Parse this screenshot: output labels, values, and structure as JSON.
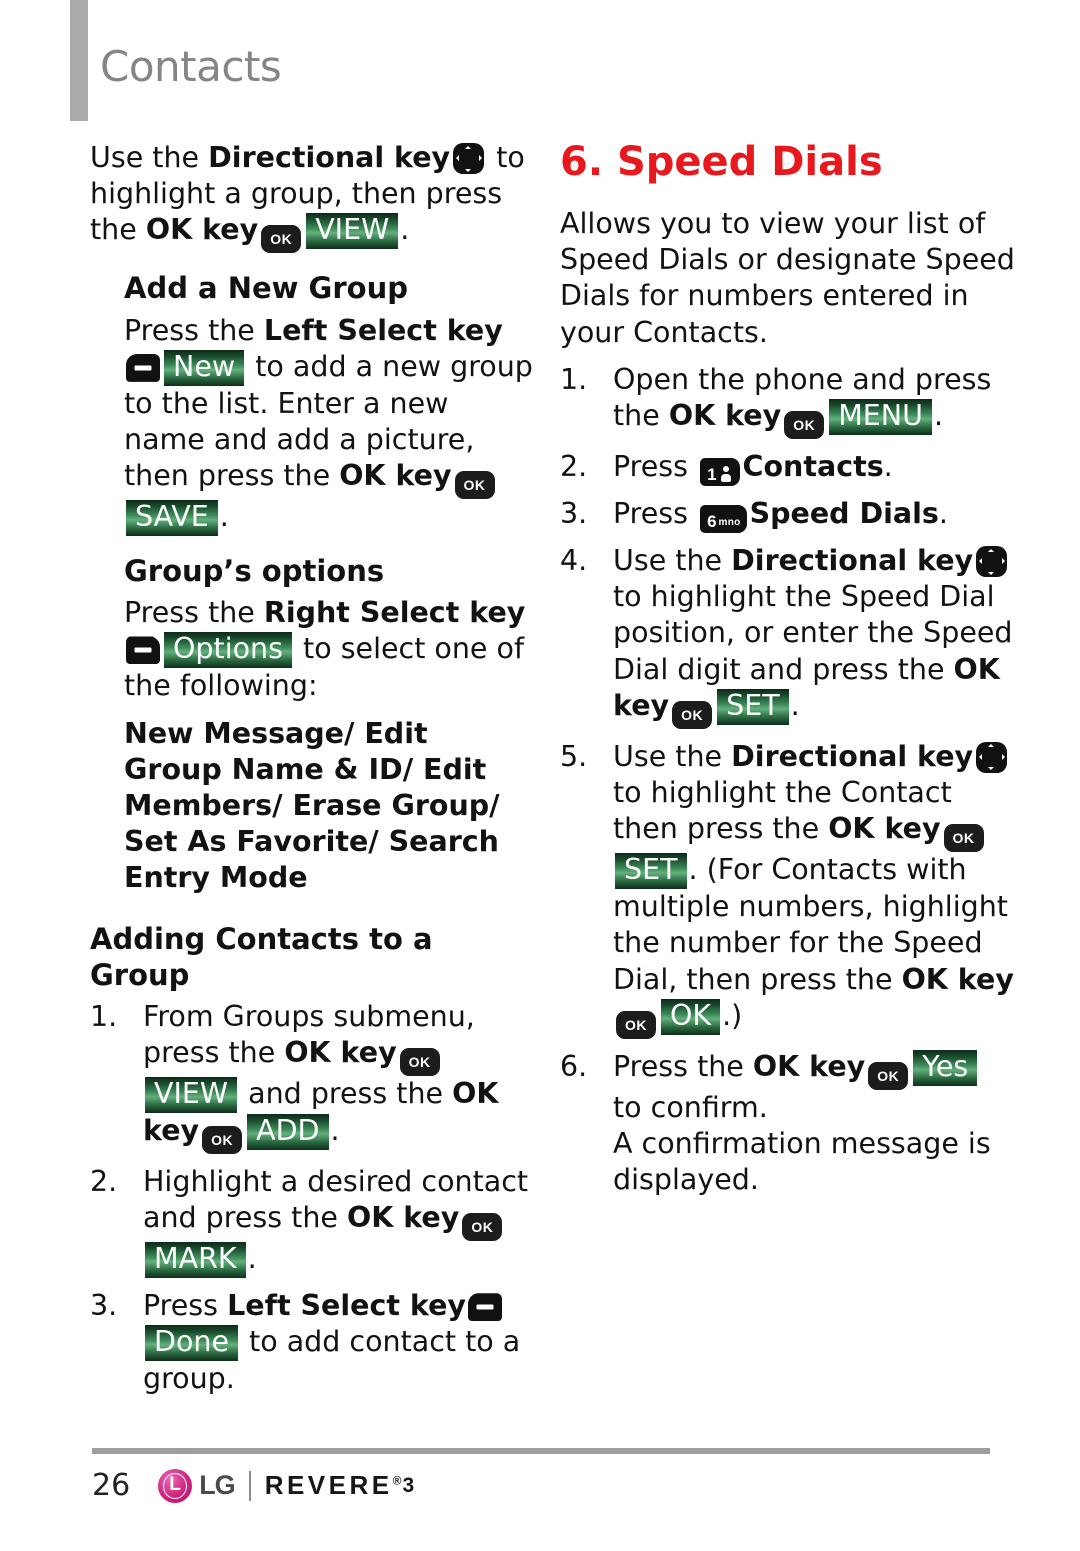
{
  "header": {
    "title": "Contacts"
  },
  "left_column": {
    "intro": {
      "p1_a": "Use the ",
      "p1_b": "Directional key",
      "p1_c": " to highlight a group, then press the ",
      "p1_d": "OK key",
      "p1_badge": "VIEW",
      "p1_end": "."
    },
    "add_new_group": {
      "heading": "Add a New Group",
      "p_a": "Press the ",
      "p_b": "Left Select key",
      "badge_new": "New",
      "p_c": " to add a new group to the list. Enter a new name and add a picture, then press the ",
      "p_d": "OK key",
      "badge_save": "SAVE",
      "p_end": "."
    },
    "group_options": {
      "heading": "Group’s options",
      "p_a": "Press the ",
      "p_b": "Right Select key",
      "badge_options": "Options",
      "p_c": " to select one of the following:",
      "options_list": "New Message/ Edit Group Name & ID/ Edit Members/ Erase Group/ Set As Favorite/ Search Entry Mode"
    },
    "adding_contacts": {
      "heading": "Adding Contacts to a Group",
      "steps": [
        {
          "num": "1.",
          "a": "From Groups submenu, press the ",
          "b": "OK key",
          "badge1": "VIEW",
          "c": " and press the ",
          "d": "OK key",
          "badge2": "ADD",
          "e": "."
        },
        {
          "num": "2.",
          "a": "Highlight a desired contact and press the ",
          "b": "OK key",
          "badge1": "MARK",
          "c": "."
        },
        {
          "num": "3.",
          "a": "Press ",
          "b": "Left Select key",
          "badge1": "Done",
          "c": " to add contact to a group."
        }
      ]
    }
  },
  "right_column": {
    "section_heading": "6. Speed Dials",
    "intro": "Allows you to view your list of Speed Dials or designate Speed Dials for numbers entered in your Contacts.",
    "steps": [
      {
        "num": "1.",
        "a": "Open the phone and press the ",
        "b": "OK key",
        "badge1": "MENU",
        "c": "."
      },
      {
        "num": "2.",
        "a": "Press ",
        "key_digit": "1",
        "b": "Contacts",
        "c": "."
      },
      {
        "num": "3.",
        "a": "Press ",
        "key_digit": "6",
        "key_letters": "mno",
        "b": "Speed Dials",
        "c": "."
      },
      {
        "num": "4.",
        "a": "Use the ",
        "b": "Directional key",
        "c": " to highlight the Speed Dial position, or enter the Speed Dial digit and press the ",
        "d": "OK key",
        "badge1": "SET",
        "e": "."
      },
      {
        "num": "5.",
        "a": "Use the ",
        "b": "Directional key",
        "c": " to highlight the Contact then press the ",
        "d": "OK key",
        "badge1": "SET",
        "e": ". (For Contacts with multiple numbers, highlight the number for the Speed Dial, then press the ",
        "f": "OK",
        "g": " key",
        "badge2": "OK",
        "h": ".)"
      },
      {
        "num": "6.",
        "a": "Press the ",
        "b": "OK key",
        "badge1": "Yes",
        "c": " to confirm.",
        "d": "A confirmation message is displayed."
      }
    ]
  },
  "footer": {
    "page_number": "26",
    "brand": "LG",
    "model": "REVERE",
    "model_mark": "®",
    "model_suffix": "3"
  },
  "colors": {
    "heading_red": "#e8191e",
    "title_gray": "#858585",
    "badge_green": "#3b8957",
    "lg_magenta": "#d0237e"
  }
}
